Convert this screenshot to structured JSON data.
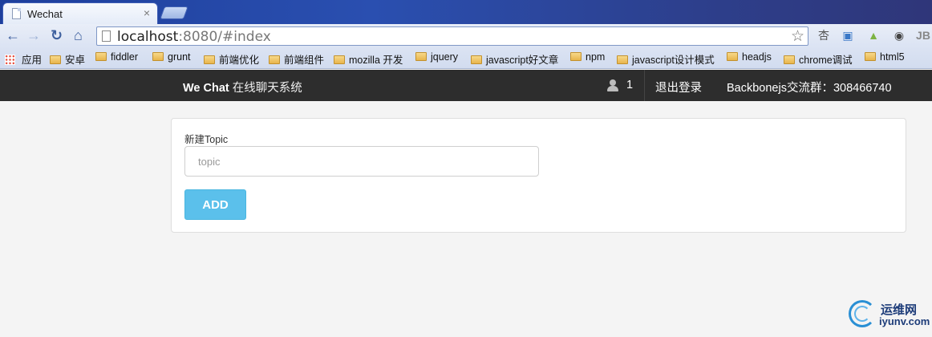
{
  "browser": {
    "tab_title": "Wechat",
    "tab_close": "×",
    "url_host": "localhost",
    "url_rest": ":8080/#index",
    "star": "☆"
  },
  "bookmarks": [
    {
      "label": "应用",
      "icon": "apps-grid-icon"
    },
    {
      "label": "安卓",
      "icon": "folder-icon"
    },
    {
      "label": "fiddler",
      "icon": "folder-icon"
    },
    {
      "label": "grunt",
      "icon": "folder-icon"
    },
    {
      "label": "前端优化",
      "icon": "folder-icon"
    },
    {
      "label": "前端组件",
      "icon": "folder-icon"
    },
    {
      "label": "mozilla 开发",
      "icon": "folder-icon"
    },
    {
      "label": "jquery",
      "icon": "folder-icon"
    },
    {
      "label": "javascript好文章",
      "icon": "folder-icon"
    },
    {
      "label": "npm",
      "icon": "folder-icon"
    },
    {
      "label": "javascript设计模式",
      "icon": "folder-icon"
    },
    {
      "label": "headjs",
      "icon": "folder-icon"
    },
    {
      "label": "chrome调试",
      "icon": "folder-icon"
    },
    {
      "label": "html5",
      "icon": "folder-icon"
    }
  ],
  "navbar": {
    "brand_bold": "We Chat",
    "brand_sub": "在线聊天系统",
    "user_count": "1",
    "logout": "退出登录",
    "group": "Backbonejs交流群：308466740"
  },
  "form": {
    "label": "新建Topic",
    "placeholder": "topic",
    "value": "",
    "add_label": "ADD"
  },
  "watermark": {
    "cn": "运维网",
    "en": "iyunv.com"
  },
  "colors": {
    "navbar_bg": "#2d2d2d",
    "add_button": "#5bc0eb",
    "page_bg": "#f4f4f4"
  }
}
